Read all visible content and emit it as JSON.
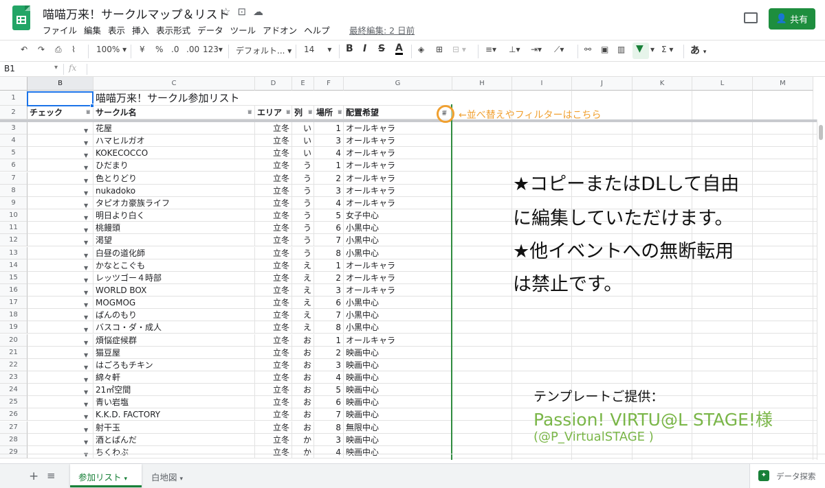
{
  "header": {
    "doc_title": "喵喵万来！サークルマップ＆リスト",
    "title_icons": [
      "star-icon",
      "folder-move-icon",
      "cloud-status-icon"
    ],
    "menu": [
      "ファイル",
      "編集",
      "表示",
      "挿入",
      "表示形式",
      "データ",
      "ツール",
      "アドオン",
      "ヘルプ"
    ],
    "last_edit": "最終編集: 2 日前",
    "share_label": "共有"
  },
  "toolbar": {
    "zoom": "100%",
    "currency": "¥",
    "percent": "%",
    "decimal_dec": ".0",
    "decimal_inc": ".00",
    "more_formats": "123",
    "font": "デフォルト...",
    "font_size": "14",
    "bold": "B",
    "italic": "I",
    "strike": "S",
    "text_color": "A",
    "input_method": "あ",
    "function": "Σ"
  },
  "formula_bar": {
    "name_box": "B1",
    "fx": "fx",
    "value": ""
  },
  "columns": [
    "B",
    "C",
    "D",
    "E",
    "F",
    "G",
    "H",
    "I",
    "J",
    "K",
    "L",
    "M"
  ],
  "title_cell": "喵喵万来！サークル参加リスト",
  "table_headers": {
    "check": "チェック",
    "name": "サークル名",
    "area": "エリア",
    "row": "列",
    "place": "場所",
    "preference": "配置希望"
  },
  "rows": [
    {
      "num": "3",
      "name": "花屋",
      "area": "立冬",
      "row": "い",
      "place": "1",
      "pref": "オールキャラ"
    },
    {
      "num": "4",
      "name": "ハマヒルガオ",
      "area": "立冬",
      "row": "い",
      "place": "3",
      "pref": "オールキャラ"
    },
    {
      "num": "5",
      "name": "KOKECOCCO",
      "area": "立冬",
      "row": "い",
      "place": "4",
      "pref": "オールキャラ"
    },
    {
      "num": "6",
      "name": "ひだまり",
      "area": "立冬",
      "row": "う",
      "place": "1",
      "pref": "オールキャラ"
    },
    {
      "num": "7",
      "name": "色とりどり",
      "area": "立冬",
      "row": "う",
      "place": "2",
      "pref": "オールキャラ"
    },
    {
      "num": "8",
      "name": "nukadoko",
      "area": "立冬",
      "row": "う",
      "place": "3",
      "pref": "オールキャラ"
    },
    {
      "num": "9",
      "name": "タピオカ豪族ライフ",
      "area": "立冬",
      "row": "う",
      "place": "4",
      "pref": "オールキャラ"
    },
    {
      "num": "10",
      "name": "明日より白く",
      "area": "立冬",
      "row": "う",
      "place": "5",
      "pref": "女子中心"
    },
    {
      "num": "11",
      "name": "桃饅頭",
      "area": "立冬",
      "row": "う",
      "place": "6",
      "pref": "小黒中心"
    },
    {
      "num": "12",
      "name": "渇望",
      "area": "立冬",
      "row": "う",
      "place": "7",
      "pref": "小黒中心"
    },
    {
      "num": "13",
      "name": "白昼の道化師",
      "area": "立冬",
      "row": "う",
      "place": "8",
      "pref": "小黒中心"
    },
    {
      "num": "14",
      "name": "かなとこぐも",
      "area": "立冬",
      "row": "え",
      "place": "1",
      "pref": "オールキャラ"
    },
    {
      "num": "15",
      "name": "レッツゴー４時部",
      "area": "立冬",
      "row": "え",
      "place": "2",
      "pref": "オールキャラ"
    },
    {
      "num": "16",
      "name": "WORLD BOX",
      "area": "立冬",
      "row": "え",
      "place": "3",
      "pref": "オールキャラ"
    },
    {
      "num": "17",
      "name": "MOGMOG",
      "area": "立冬",
      "row": "え",
      "place": "6",
      "pref": "小黒中心"
    },
    {
      "num": "18",
      "name": "ぱんのもり",
      "area": "立冬",
      "row": "え",
      "place": "7",
      "pref": "小黒中心"
    },
    {
      "num": "19",
      "name": "バスコ・ダ・成人",
      "area": "立冬",
      "row": "え",
      "place": "8",
      "pref": "小黒中心"
    },
    {
      "num": "20",
      "name": "煩悩症候群",
      "area": "立冬",
      "row": "お",
      "place": "1",
      "pref": "オールキャラ"
    },
    {
      "num": "21",
      "name": "猫豆屋",
      "area": "立冬",
      "row": "お",
      "place": "2",
      "pref": "映画中心"
    },
    {
      "num": "22",
      "name": "はごろもチキン",
      "area": "立冬",
      "row": "お",
      "place": "3",
      "pref": "映画中心"
    },
    {
      "num": "23",
      "name": "綿々軒",
      "area": "立冬",
      "row": "お",
      "place": "4",
      "pref": "映画中心"
    },
    {
      "num": "24",
      "name": "21㎡空間",
      "area": "立冬",
      "row": "お",
      "place": "5",
      "pref": "映画中心"
    },
    {
      "num": "25",
      "name": "青い岩塩",
      "area": "立冬",
      "row": "お",
      "place": "6",
      "pref": "映画中心"
    },
    {
      "num": "26",
      "name": "K.K.D. FACTORY",
      "area": "立冬",
      "row": "お",
      "place": "7",
      "pref": "映画中心"
    },
    {
      "num": "27",
      "name": "射干玉",
      "area": "立冬",
      "row": "お",
      "place": "8",
      "pref": "無限中心"
    },
    {
      "num": "28",
      "name": "酒とぱんだ",
      "area": "立冬",
      "row": "か",
      "place": "3",
      "pref": "映画中心"
    },
    {
      "num": "29",
      "name": "ちくわぶ",
      "area": "立冬",
      "row": "か",
      "place": "4",
      "pref": "映画中心"
    }
  ],
  "overlay": {
    "callout": "←並べ替えやフィルターはこちら",
    "note_lines": [
      "★コピーまたはDLして自由",
      "に編集していただけます。",
      "★他イベントへの無断転用",
      "は禁止です。"
    ],
    "credit_label": "テンプレートご提供：",
    "credit_name": "Passion! VIRTU@L STAGE!様",
    "credit_handle": "(@P_VirtualSTAGE )"
  },
  "tabs": {
    "active": "参加リスト",
    "inactive": "白地図",
    "explore": "データ探索"
  },
  "colors": {
    "brand_green": "#1e8e3e",
    "callout_orange": "#f0a030",
    "credit_green": "#7ab648",
    "selection_blue": "#1a73e8"
  }
}
